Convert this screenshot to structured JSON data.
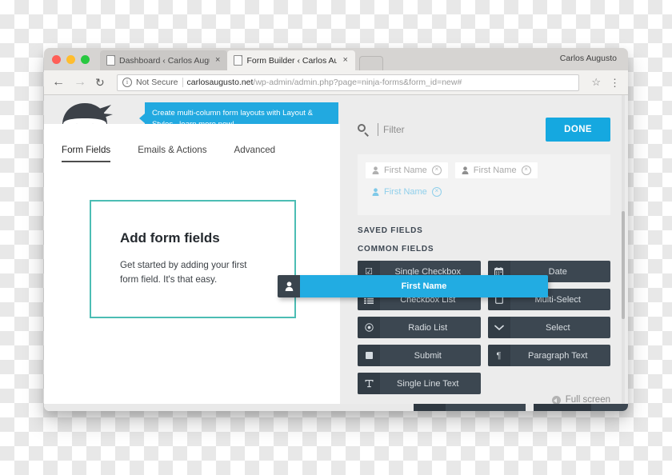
{
  "browser": {
    "profile_name": "Carlos Augusto",
    "tabs": [
      {
        "title": "Dashboard ‹ Carlos Augusto —",
        "close": "×",
        "active": false
      },
      {
        "title": "Form Builder ‹ Carlos Augusto",
        "close": "×",
        "active": true
      }
    ],
    "nav": {
      "back": "←",
      "forward": "→",
      "reload": "↻",
      "star": "☆",
      "menu": "⋮"
    },
    "omnibox": {
      "info_glyph": "i",
      "security_label": "Not Secure",
      "url_host": "carlosaugusto.net",
      "url_path": "/wp-admin/admin.php?page=ninja-forms&form_id=new#"
    }
  },
  "promo": {
    "text": "Create multi-column form layouts with Layout & Styles...learn more now!",
    "color": "#22a9e0"
  },
  "form_builder": {
    "tabs": [
      {
        "label": "Form Fields",
        "active": true
      },
      {
        "label": "Emails & Actions",
        "active": false
      },
      {
        "label": "Advanced",
        "active": false
      }
    ],
    "dropzone": {
      "title": "Add form fields",
      "subtitle": "Get started by adding your first form field. It's that easy.",
      "border_color": "#4cbdb4"
    }
  },
  "sidebar": {
    "search": {
      "icon": "search-icon",
      "placeholder": "Filter",
      "value": ""
    },
    "done_button": {
      "label": "DONE",
      "color": "#15a8e0"
    },
    "saved_fields_chips": [
      {
        "label": "First Name",
        "icon": "person-icon",
        "remove": "×"
      },
      {
        "label": "First Name",
        "icon": "person-icon",
        "remove": "×"
      },
      {
        "label": "First Name",
        "icon": "person-icon",
        "remove": "×"
      }
    ],
    "section_saved": "SAVED FIELDS",
    "section_common": "COMMON FIELDS",
    "common_fields": [
      {
        "label": "Single Checkbox",
        "icon": "checkbox-checked-icon",
        "glyph": "☑"
      },
      {
        "label": "Date",
        "icon": "calendar-icon",
        "glyph": "Ὄ5"
      },
      {
        "label": "Checkbox List",
        "icon": "list-icon",
        "glyph": "☰"
      },
      {
        "label": "Multi-Select",
        "icon": "square-icon",
        "glyph": "□"
      },
      {
        "label": "Radio List",
        "icon": "radio-icon",
        "glyph": "◉"
      },
      {
        "label": "Select",
        "icon": "chevron-down-icon",
        "glyph": "⌄"
      },
      {
        "label": "Submit",
        "icon": "filled-square-icon",
        "glyph": "■"
      },
      {
        "label": "Paragraph Text",
        "icon": "pilcrow-icon",
        "glyph": "¶"
      },
      {
        "label": "Single Line Text",
        "icon": "text-cursor-icon",
        "glyph": "T"
      }
    ],
    "fullscreen": {
      "label": "Full screen",
      "icon": "fullscreen-icon"
    }
  },
  "drag_item": {
    "label": "First Name",
    "icon": "person-icon",
    "color": "#22ace2"
  }
}
